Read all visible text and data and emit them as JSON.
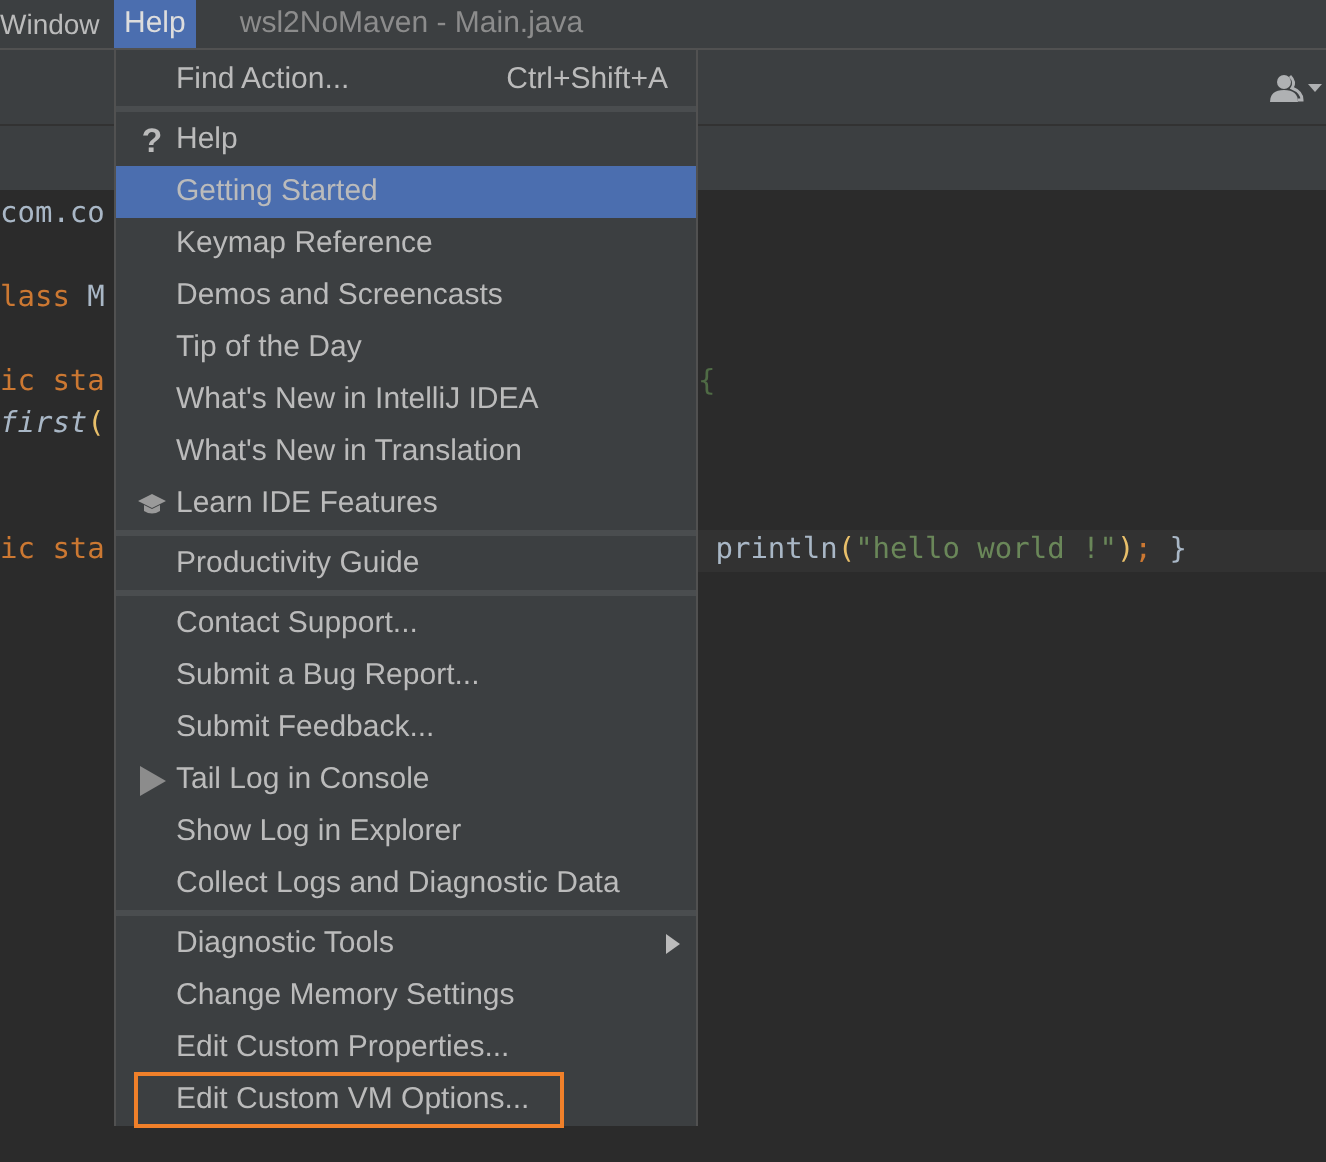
{
  "menu_bar": [
    {
      "label": "Window",
      "selected": false
    },
    {
      "label": "Help",
      "selected": true
    }
  ],
  "window_title": "wsl2NoMaven - Main.java",
  "code_lines": [
    {
      "current": false,
      "left": [
        {
          "text": "com.co",
          "kind": "plain"
        }
      ]
    },
    {
      "current": false
    },
    {
      "current": false,
      "left": [
        {
          "text": "lass ",
          "kind": "keyword"
        },
        {
          "text": "M",
          "kind": "plain"
        }
      ]
    },
    {
      "current": false
    },
    {
      "current": false,
      "left": [
        {
          "text": "ic sta",
          "kind": "keyword"
        }
      ],
      "right": [
        {
          "text": "{",
          "kind": "faded"
        }
      ]
    },
    {
      "current": false,
      "left": [
        {
          "text": "first",
          "kind": "italic"
        },
        {
          "text": "(",
          "kind": "paren"
        }
      ]
    },
    {
      "current": false
    },
    {
      "current": false
    },
    {
      "current": true,
      "left": [
        {
          "text": "ic sta",
          "kind": "keyword"
        }
      ],
      "right": [
        {
          "text": " println",
          "kind": "plain"
        },
        {
          "text": "(",
          "kind": "paren"
        },
        {
          "text": "\"hello world !\"",
          "kind": "string"
        },
        {
          "text": ")",
          "kind": "paren"
        },
        {
          "text": ";",
          "kind": "keyword"
        },
        {
          "text": " }",
          "kind": "plain"
        }
      ]
    }
  ],
  "menu": {
    "groups": [
      [
        {
          "label": "Find Action...",
          "kind": "plain",
          "shortcut": "Ctrl+Shift+A",
          "selected": false,
          "highlighted": false
        }
      ],
      [
        {
          "label": "Help",
          "kind": "question",
          "icon": "?",
          "selected": false,
          "highlighted": false
        },
        {
          "label": "Getting Started",
          "kind": "plain",
          "selected": true,
          "highlighted": false
        },
        {
          "label": "Keymap Reference",
          "kind": "plain",
          "selected": false,
          "highlighted": false
        },
        {
          "label": "Demos and Screencasts",
          "kind": "plain",
          "selected": false,
          "highlighted": false
        },
        {
          "label": "Tip of the Day",
          "kind": "plain",
          "selected": false,
          "highlighted": false
        },
        {
          "label": "What's New in IntelliJ IDEA",
          "kind": "plain",
          "selected": false,
          "highlighted": false
        },
        {
          "label": "What's New in Translation",
          "kind": "plain",
          "selected": false,
          "highlighted": false
        },
        {
          "label": "Learn IDE Features",
          "kind": "learn",
          "selected": false,
          "highlighted": false
        }
      ],
      [
        {
          "label": "Productivity Guide",
          "kind": "plain",
          "selected": false,
          "highlighted": false
        }
      ],
      [
        {
          "label": "Contact Support...",
          "kind": "plain",
          "selected": false,
          "highlighted": false
        },
        {
          "label": "Submit a Bug Report...",
          "kind": "plain",
          "selected": false,
          "highlighted": false
        },
        {
          "label": "Submit Feedback...",
          "kind": "plain",
          "selected": false,
          "highlighted": false
        },
        {
          "label": "Tail Log in Console",
          "kind": "run",
          "selected": false,
          "highlighted": false
        },
        {
          "label": "Show Log in Explorer",
          "kind": "plain",
          "selected": false,
          "highlighted": false
        },
        {
          "label": "Collect Logs and Diagnostic Data",
          "kind": "plain",
          "selected": false,
          "highlighted": false
        }
      ],
      [
        {
          "label": "Diagnostic Tools",
          "kind": "submenu",
          "selected": false,
          "highlighted": false
        },
        {
          "label": "Change Memory Settings",
          "kind": "plain",
          "selected": false,
          "highlighted": false
        },
        {
          "label": "Edit Custom Properties...",
          "kind": "plain",
          "selected": false,
          "highlighted": false
        },
        {
          "label": "Edit Custom VM Options...",
          "kind": "plain",
          "selected": false,
          "highlighted": true
        }
      ]
    ]
  }
}
